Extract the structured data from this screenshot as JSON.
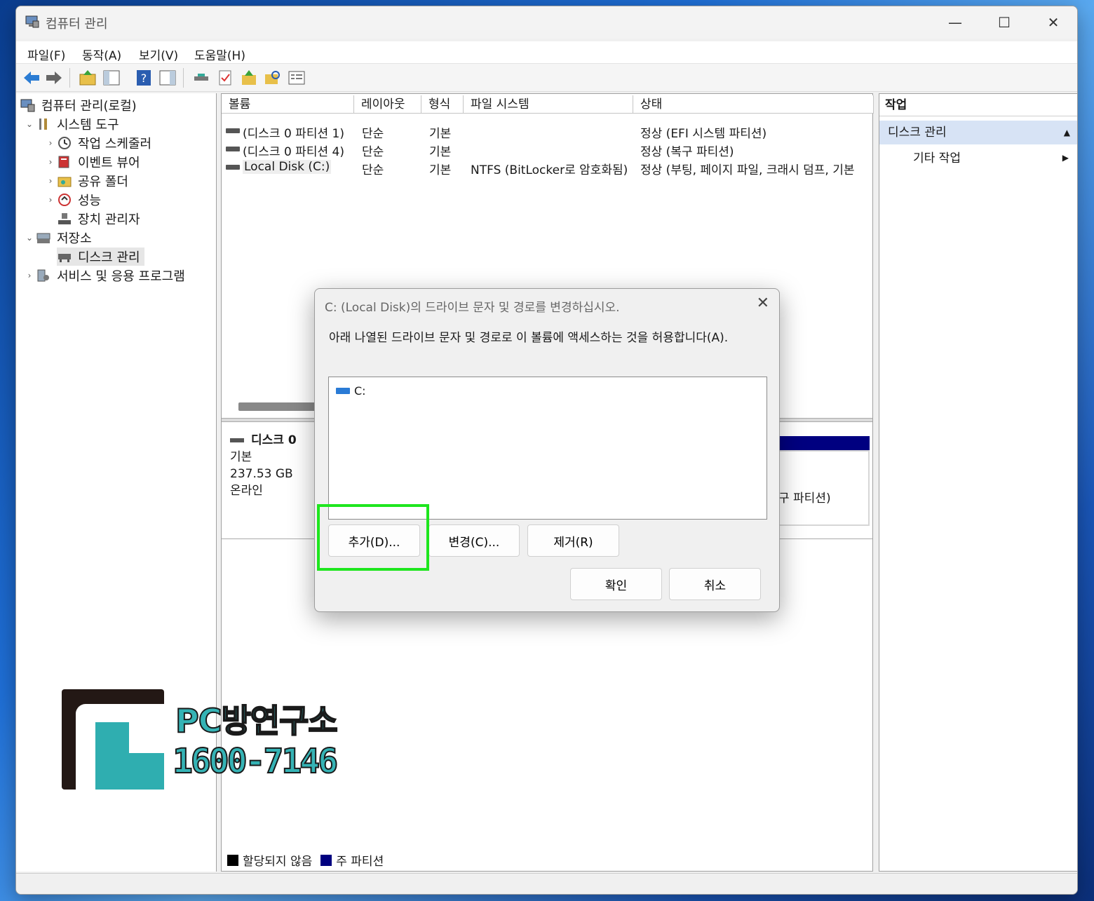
{
  "window": {
    "title": "컴퓨터 관리",
    "controls": {
      "minimize": "—",
      "maximize": "☐",
      "close": "✕"
    }
  },
  "menu": [
    "파일(F)",
    "동작(A)",
    "보기(V)",
    "도움말(H)"
  ],
  "tree": {
    "root": "컴퓨터 관리(로컬)",
    "system_tools": "시스템 도구",
    "task_scheduler": "작업 스케줄러",
    "event_viewer": "이벤트 뷰어",
    "shared_folders": "공유 폴더",
    "performance": "성능",
    "device_manager": "장치 관리자",
    "storage": "저장소",
    "disk_management": "디스크 관리",
    "services_apps": "서비스 및 응용 프로그램"
  },
  "volumes": {
    "columns": [
      "볼륨",
      "레이아웃",
      "형식",
      "파일 시스템",
      "상태"
    ],
    "rows": [
      {
        "volume": "(디스크 0 파티션 1)",
        "layout": "단순",
        "type": "기본",
        "fs": "",
        "status": "정상 (EFI 시스템 파티션)"
      },
      {
        "volume": "(디스크 0 파티션 4)",
        "layout": "단순",
        "type": "기본",
        "fs": "",
        "status": "정상 (복구 파티션)"
      },
      {
        "volume": "Local Disk (C:)",
        "layout": "단순",
        "type": "기본",
        "fs": "NTFS (BitLocker로 암호화됨)",
        "status": "정상 (부팅, 페이지 파일, 크래시 덤프, 기본"
      }
    ]
  },
  "disk": {
    "name": "디스크 0",
    "kind": "기본",
    "size": "237.53 GB",
    "state": "온라인",
    "partition_label": "구 파티션)"
  },
  "legend": {
    "unallocated": "할당되지 않음",
    "primary": "주 파티션",
    "unallocated_color": "#000000",
    "primary_color": "#000080"
  },
  "actions": {
    "header": "작업",
    "section": "디스크 관리",
    "more": "기타 작업"
  },
  "dialog": {
    "title": "C: (Local Disk)의 드라이브 문자 및 경로를 변경하십시오.",
    "description": "아래 나열된 드라이브 문자 및 경로로 이 볼륨에 액세스하는 것을 허용합니다(A).",
    "items": [
      "C:"
    ],
    "add": "추가(D)...",
    "change": "변경(C)...",
    "remove": "제거(R)",
    "ok": "확인",
    "cancel": "취소",
    "highlight_color": "#1ee61e"
  },
  "watermark": {
    "name": "PC방연구소",
    "phone": "1600-7146"
  }
}
